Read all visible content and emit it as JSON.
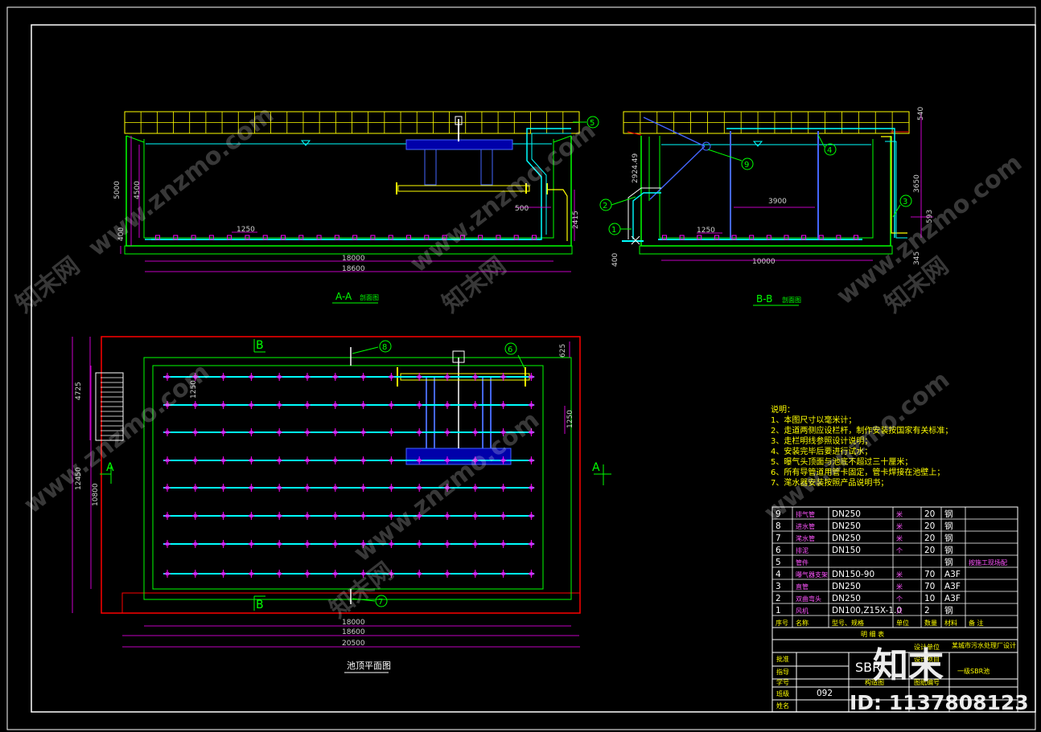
{
  "views": {
    "aa_section_title": "A-A",
    "aa_section_suffix": "剖面图",
    "bb_section_title": "B-B",
    "bb_section_suffix": "剖面图",
    "plan_title": "池顶平面图"
  },
  "aa_dims": {
    "height_5000": "5000",
    "height_4500": "4500",
    "base_400": "400",
    "spacing_1250": "1250",
    "inner_18000": "18000",
    "outer_18600": "18600",
    "d_500": "500",
    "d_2415": "2415"
  },
  "bb_dims": {
    "top_540": "540",
    "d_2924": "2924.49",
    "d_3650": "3650",
    "d_593": "593",
    "d_345": "345",
    "base_400": "400",
    "spacing_1250": "1250",
    "inner_10000": "10000",
    "d_3900": "3900"
  },
  "plan_dims": {
    "d_4725": "4725",
    "d_12450": "12450",
    "d_10800": "10800",
    "d_1250a": "1250",
    "d_1250b": "1250",
    "d_625": "625",
    "w_18000": "18000",
    "w_18600": "18600",
    "w_20500": "20500"
  },
  "section_marks": {
    "a_left": "A",
    "a_right": "A",
    "b_top": "B",
    "b_bottom": "B"
  },
  "callouts": [
    "1",
    "2",
    "3",
    "4",
    "5",
    "6",
    "7",
    "8",
    "9"
  ],
  "notes": {
    "heading": "说明：",
    "items": [
      "1、本图尺寸以毫米计；",
      "2、走道两侧应设栏杆，制作安装按国家有关标准；",
      "3、走栏明线参照设计说明；",
      "4、安装完毕后要进行试水；",
      "5、曝气头顶面与池底不超过三十厘米；",
      "6、所有导管道用管卡固定，管卡焊接在池壁上；",
      "7、滗水器安装按照产品说明书；"
    ]
  },
  "materials_table": {
    "headers": [
      "序号",
      "名称",
      "型号、规格",
      "单位",
      "数量",
      "材料",
      "备 注"
    ],
    "rows": [
      {
        "no": "9",
        "name": "排气管",
        "spec": "DN250",
        "unit": "米",
        "qty": "20",
        "mat": "钢",
        "remark": ""
      },
      {
        "no": "8",
        "name": "进水管",
        "spec": "DN250",
        "unit": "米",
        "qty": "20",
        "mat": "钢",
        "remark": ""
      },
      {
        "no": "7",
        "name": "滗水管",
        "spec": "DN250",
        "unit": "米",
        "qty": "20",
        "mat": "钢",
        "remark": ""
      },
      {
        "no": "6",
        "name": "排泥",
        "spec": "DN150",
        "unit": "个",
        "qty": "20",
        "mat": "钢",
        "remark": ""
      },
      {
        "no": "5",
        "name": "管件",
        "spec": "",
        "unit": "",
        "qty": "",
        "mat": "钢",
        "remark": "按施工现场配"
      },
      {
        "no": "4",
        "name": "曝气器支架",
        "spec": "DN150-90",
        "unit": "米",
        "qty": "70",
        "mat": "A3F",
        "remark": ""
      },
      {
        "no": "3",
        "name": "直管",
        "spec": "DN250",
        "unit": "米",
        "qty": "70",
        "mat": "A3F",
        "remark": ""
      },
      {
        "no": "2",
        "name": "双曲弯头",
        "spec": "DN250",
        "unit": "个",
        "qty": "10",
        "mat": "A3F",
        "remark": ""
      },
      {
        "no": "1",
        "name": "风机",
        "spec": "DN100,Z15X-1.0",
        "unit": "只",
        "qty": "2",
        "mat": "钢",
        "remark": ""
      }
    ],
    "footer": "明 细 表"
  },
  "title_block": {
    "left_labels": [
      "批准",
      "指导",
      "学号",
      "班级",
      "姓名"
    ],
    "class_no": "092",
    "drawing_title": "SBR",
    "sub_title": "构造图",
    "right_labels": [
      "设计单位",
      "设计项目",
      "图纸编号"
    ],
    "project": "某城市污水处理厂设计",
    "drawing_no": "一级SBR池"
  },
  "watermark": {
    "site": "www.znzmo.com",
    "brand": "知末网",
    "logo": "知末",
    "id_text": "ID: 1137808123"
  },
  "colors": {
    "background": "#000000",
    "frame": "#ffffff",
    "wall": "#00ff00",
    "parapet": "#ffff00",
    "air_pipe": "#00ffff",
    "blue_pipe": "#0000ff",
    "plan_boundary": "#ff0000",
    "diffuser": "#ff00ff",
    "callout": "#00ff00",
    "dim_line": "#ff00ff"
  }
}
